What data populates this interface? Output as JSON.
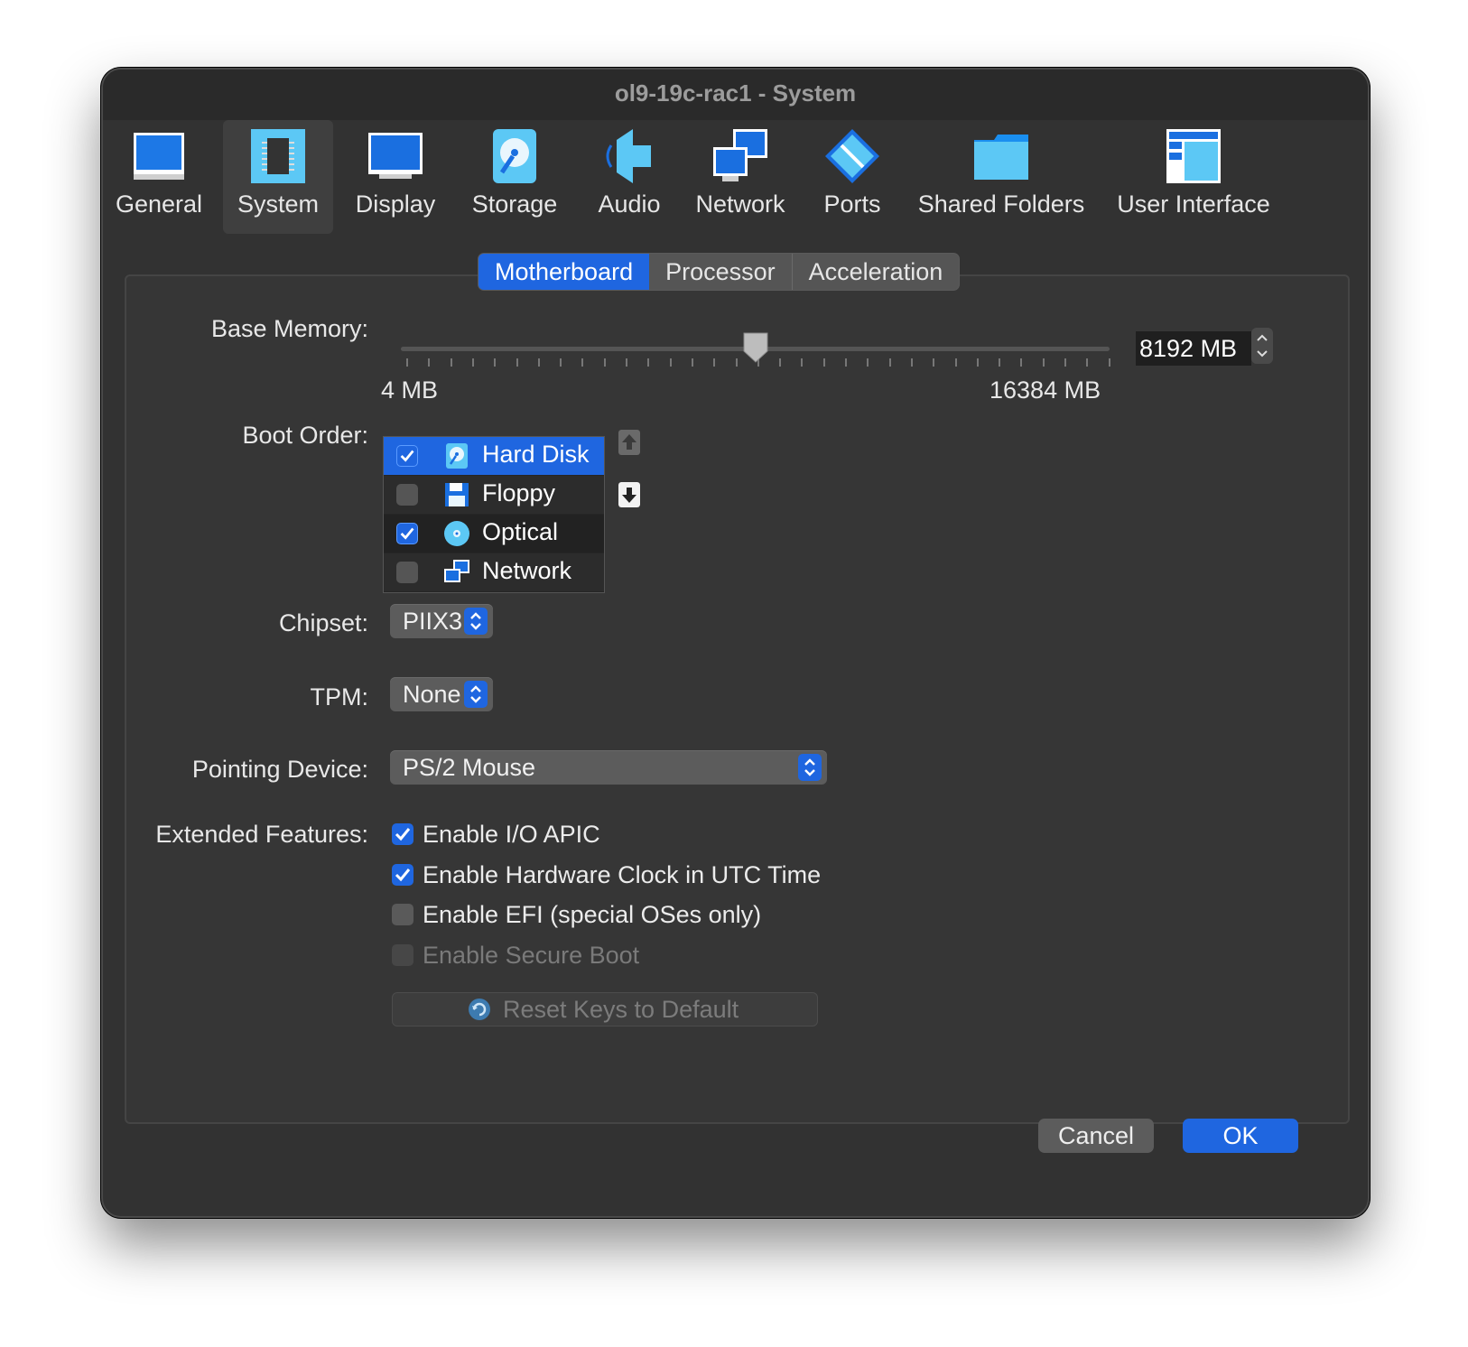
{
  "window": {
    "title": "ol9-19c-rac1 - System"
  },
  "toolbar": {
    "items": [
      {
        "label": "General"
      },
      {
        "label": "System"
      },
      {
        "label": "Display"
      },
      {
        "label": "Storage"
      },
      {
        "label": "Audio"
      },
      {
        "label": "Network"
      },
      {
        "label": "Ports"
      },
      {
        "label": "Shared Folders"
      },
      {
        "label": "User Interface"
      }
    ],
    "selected": "System"
  },
  "tabs": [
    {
      "label": "Motherboard",
      "active": true
    },
    {
      "label": "Processor",
      "active": false
    },
    {
      "label": "Acceleration",
      "active": false
    }
  ],
  "motherboard": {
    "base_memory_label": "Base Memory:",
    "base_memory_value": "8192 MB",
    "memory_min": "4 MB",
    "memory_max": "16384 MB",
    "memory_slider_fraction": 0.5,
    "boot_order_label": "Boot Order:",
    "boot_items": [
      {
        "label": "Hard Disk",
        "checked": true,
        "icon": "hard-disk-icon"
      },
      {
        "label": "Floppy",
        "checked": false,
        "icon": "floppy-icon"
      },
      {
        "label": "Optical",
        "checked": true,
        "icon": "optical-disc-icon"
      },
      {
        "label": "Network",
        "checked": false,
        "icon": "network-icon"
      }
    ],
    "chipset_label": "Chipset:",
    "chipset_value": "PIIX3",
    "tpm_label": "TPM:",
    "tpm_value": "None",
    "pointing_label": "Pointing Device:",
    "pointing_value": "PS/2 Mouse",
    "extended_label": "Extended Features:",
    "features": [
      {
        "label": "Enable I/O APIC",
        "checked": true,
        "enabled": true
      },
      {
        "label": "Enable Hardware Clock in UTC Time",
        "checked": true,
        "enabled": true
      },
      {
        "label": "Enable EFI (special OSes only)",
        "checked": false,
        "enabled": true
      },
      {
        "label": "Enable Secure Boot",
        "checked": false,
        "enabled": false
      }
    ],
    "reset_keys_label": "Reset Keys to Default"
  },
  "buttons": {
    "cancel": "Cancel",
    "ok": "OK"
  },
  "colors": {
    "accent": "#1f66e0",
    "window_bg": "#323232",
    "icon_blue": "#2a8df5"
  }
}
